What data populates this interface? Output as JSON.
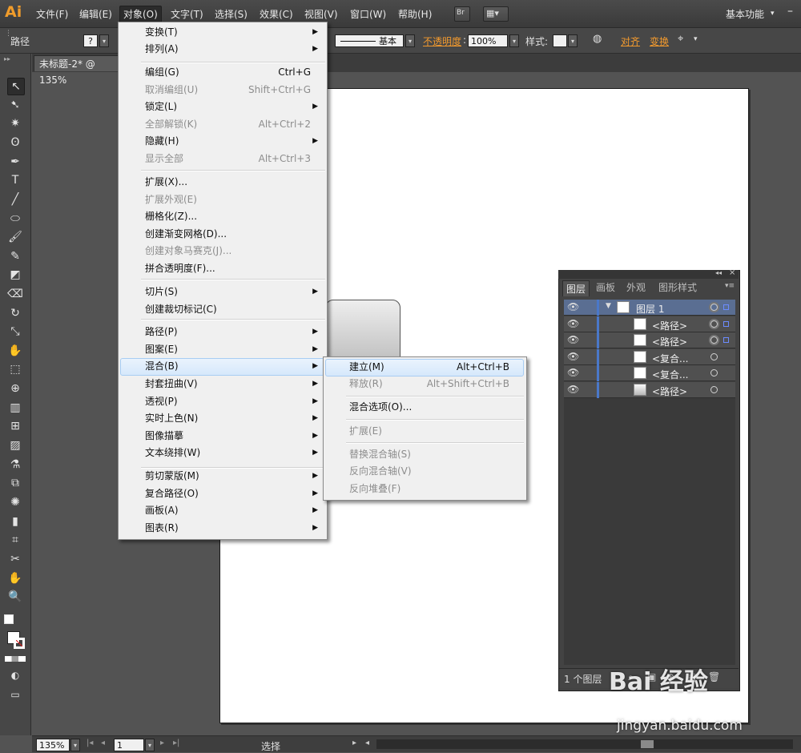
{
  "app": {
    "logo": "Ai",
    "workspace": "基本功能"
  },
  "menubar": {
    "items": [
      "文件(F)",
      "编辑(E)",
      "对象(O)",
      "文字(T)",
      "选择(S)",
      "效果(C)",
      "视图(V)",
      "窗口(W)",
      "帮助(H)"
    ],
    "bridge_label": "Br"
  },
  "control": {
    "selection_label": "路径",
    "stroke_profile": "基本",
    "opacity_label": "不透明度",
    "opacity_value": "100%",
    "style_label": "样式:",
    "align_label": "对齐",
    "transform_label": "变换"
  },
  "document": {
    "tab_title": "未标题-2* @ 135%"
  },
  "object_menu": {
    "items": [
      {
        "label": "变换(T)",
        "shortcut": "",
        "submenu": true,
        "disabled": false
      },
      {
        "label": "排列(A)",
        "shortcut": "",
        "submenu": true,
        "disabled": false
      },
      {
        "label": "编组(G)",
        "shortcut": "Ctrl+G",
        "submenu": false,
        "disabled": false
      },
      {
        "label": "取消编组(U)",
        "shortcut": "Shift+Ctrl+G",
        "submenu": false,
        "disabled": true
      },
      {
        "label": "锁定(L)",
        "shortcut": "",
        "submenu": true,
        "disabled": false
      },
      {
        "label": "全部解锁(K)",
        "shortcut": "Alt+Ctrl+2",
        "submenu": false,
        "disabled": true
      },
      {
        "label": "隐藏(H)",
        "shortcut": "",
        "submenu": true,
        "disabled": false
      },
      {
        "label": "显示全部",
        "shortcut": "Alt+Ctrl+3",
        "submenu": false,
        "disabled": true
      },
      {
        "label": "扩展(X)...",
        "shortcut": "",
        "submenu": false,
        "disabled": false
      },
      {
        "label": "扩展外观(E)",
        "shortcut": "",
        "submenu": false,
        "disabled": true
      },
      {
        "label": "栅格化(Z)...",
        "shortcut": "",
        "submenu": false,
        "disabled": false
      },
      {
        "label": "创建渐变网格(D)...",
        "shortcut": "",
        "submenu": false,
        "disabled": false
      },
      {
        "label": "创建对象马赛克(J)...",
        "shortcut": "",
        "submenu": false,
        "disabled": true
      },
      {
        "label": "拼合透明度(F)...",
        "shortcut": "",
        "submenu": false,
        "disabled": false
      },
      {
        "label": "切片(S)",
        "shortcut": "",
        "submenu": true,
        "disabled": false
      },
      {
        "label": "创建裁切标记(C)",
        "shortcut": "",
        "submenu": false,
        "disabled": false
      },
      {
        "label": "路径(P)",
        "shortcut": "",
        "submenu": true,
        "disabled": false
      },
      {
        "label": "图案(E)",
        "shortcut": "",
        "submenu": true,
        "disabled": false
      },
      {
        "label": "混合(B)",
        "shortcut": "",
        "submenu": true,
        "disabled": false
      },
      {
        "label": "封套扭曲(V)",
        "shortcut": "",
        "submenu": true,
        "disabled": false
      },
      {
        "label": "透视(P)",
        "shortcut": "",
        "submenu": true,
        "disabled": false
      },
      {
        "label": "实时上色(N)",
        "shortcut": "",
        "submenu": true,
        "disabled": false
      },
      {
        "label": "图像描摹",
        "shortcut": "",
        "submenu": true,
        "disabled": false
      },
      {
        "label": "文本绕排(W)",
        "shortcut": "",
        "submenu": true,
        "disabled": false
      },
      {
        "label": "剪切蒙版(M)",
        "shortcut": "",
        "submenu": true,
        "disabled": false
      },
      {
        "label": "复合路径(O)",
        "shortcut": "",
        "submenu": true,
        "disabled": false
      },
      {
        "label": "画板(A)",
        "shortcut": "",
        "submenu": true,
        "disabled": false
      },
      {
        "label": "图表(R)",
        "shortcut": "",
        "submenu": true,
        "disabled": false
      }
    ]
  },
  "blend_submenu": {
    "items": [
      {
        "label": "建立(M)",
        "shortcut": "Alt+Ctrl+B",
        "disabled": false
      },
      {
        "label": "释放(R)",
        "shortcut": "Alt+Shift+Ctrl+B",
        "disabled": true
      },
      {
        "label": "混合选项(O)...",
        "shortcut": "",
        "disabled": false
      },
      {
        "label": "扩展(E)",
        "shortcut": "",
        "disabled": true
      },
      {
        "label": "替换混合轴(S)",
        "shortcut": "",
        "disabled": true
      },
      {
        "label": "反向混合轴(V)",
        "shortcut": "",
        "disabled": true
      },
      {
        "label": "反向堆叠(F)",
        "shortcut": "",
        "disabled": true
      }
    ]
  },
  "layers_panel": {
    "tabs": [
      "图层",
      "画板",
      "外观",
      "图形样式"
    ],
    "rows": [
      {
        "name": "图层 1"
      },
      {
        "name": "<路径>"
      },
      {
        "name": "<路径>"
      },
      {
        "name": "<复合..."
      },
      {
        "name": "<复合..."
      },
      {
        "name": "<路径>"
      }
    ],
    "footer": "1 个图层"
  },
  "status": {
    "zoom": "135%",
    "artboard": "1",
    "tool": "选择"
  },
  "watermark": {
    "brand": "Bai 经验",
    "url": "jingyan.baidu.com"
  }
}
